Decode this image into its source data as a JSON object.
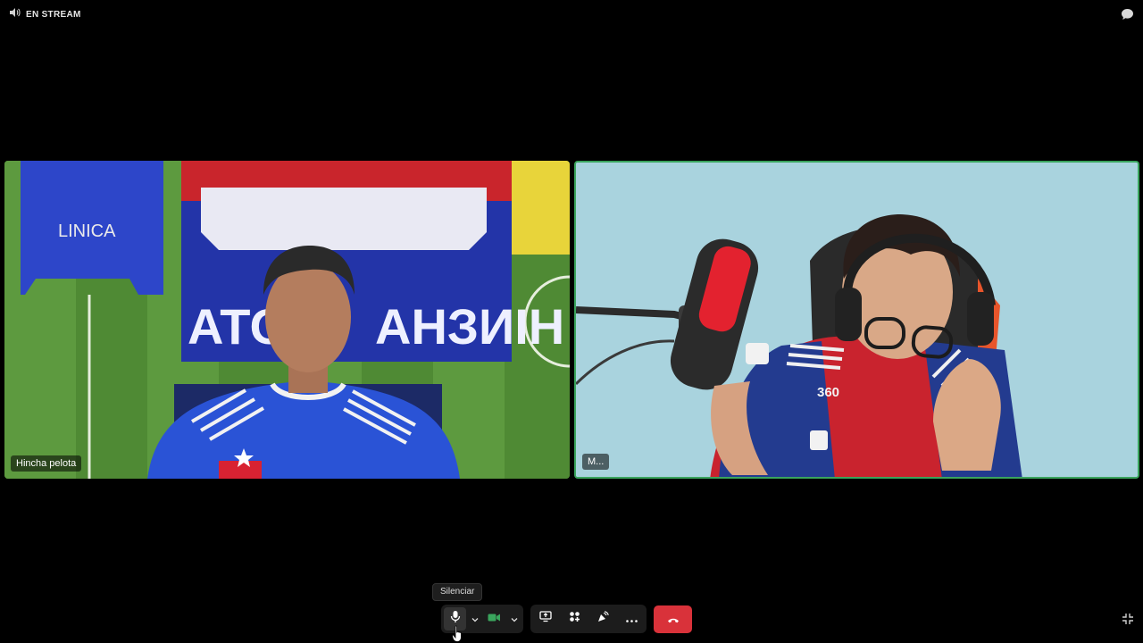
{
  "topbar": {
    "stream_label": "EN STREAM",
    "icons": {
      "volume": "volume-icon",
      "chat": "chat-bubble-icon"
    }
  },
  "participants": [
    {
      "name": "Hincha pelota",
      "speaking": false
    },
    {
      "name": "M...",
      "speaking": true
    }
  ],
  "tooltip": {
    "text": "Silenciar"
  },
  "controls": {
    "icons": [
      "microphone-icon",
      "chevron-down-icon",
      "camera-icon",
      "chevron-down-icon",
      "screen-share-icon",
      "activities-icon",
      "soundboard-icon",
      "more-icon",
      "hang-up-icon"
    ]
  },
  "colors": {
    "background": "#000000",
    "speaking_border": "#3aa55d",
    "hangup": "#d9323a",
    "camera_on": "#3aa55d"
  }
}
